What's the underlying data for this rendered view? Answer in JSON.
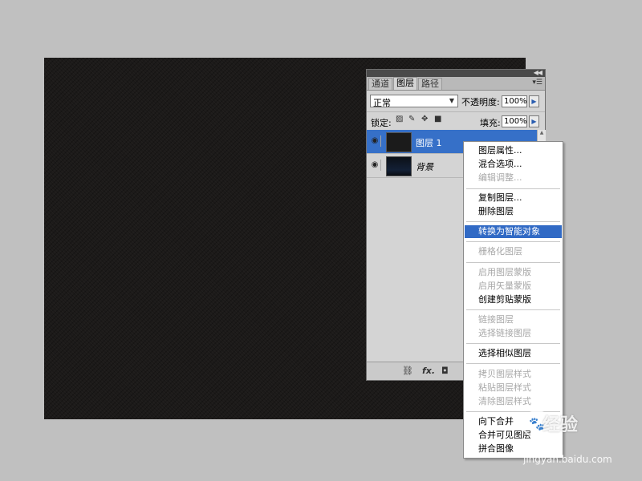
{
  "panel": {
    "collapse_icon": "double-chevron-right-icon",
    "menu_icon": "panel-menu-icon",
    "tabs": [
      {
        "label": "通道"
      },
      {
        "label": "图层"
      },
      {
        "label": "路径"
      }
    ],
    "blend_mode": "正常",
    "opacity_label": "不透明度:",
    "opacity_value": "100%",
    "lock_label": "锁定:",
    "fill_label": "填充:",
    "fill_value": "100%",
    "layers": [
      {
        "name": "图层 1",
        "selected": true,
        "visible": true
      },
      {
        "name": "背景",
        "selected": false,
        "visible": true
      }
    ],
    "footer_icons": [
      "link-icon",
      "fx-icon",
      "mask-icon"
    ]
  },
  "context_menu": {
    "items": [
      {
        "label": "图层属性...",
        "enabled": true
      },
      {
        "label": "混合选项...",
        "enabled": true
      },
      {
        "label": "编辑调整...",
        "enabled": false
      },
      {
        "label": "复制图层...",
        "enabled": true
      },
      {
        "label": "删除图层",
        "enabled": true
      },
      {
        "label": "转换为智能对象",
        "enabled": true,
        "highlighted": true
      },
      {
        "label": "栅格化图层",
        "enabled": false
      },
      {
        "label": "启用图层蒙版",
        "enabled": false
      },
      {
        "label": "启用矢量蒙版",
        "enabled": false
      },
      {
        "label": "创建剪贴蒙版",
        "enabled": true
      },
      {
        "label": "链接图层",
        "enabled": false
      },
      {
        "label": "选择链接图层",
        "enabled": false
      },
      {
        "label": "选择相似图层",
        "enabled": true
      },
      {
        "label": "拷贝图层样式",
        "enabled": false
      },
      {
        "label": "粘贴图层样式",
        "enabled": false
      },
      {
        "label": "清除图层样式",
        "enabled": false
      },
      {
        "label": "向下合并",
        "enabled": true
      },
      {
        "label": "合并可见图层",
        "enabled": true
      },
      {
        "label": "拼合图像",
        "enabled": true
      }
    ]
  },
  "watermark": {
    "brand": "经验",
    "url": "jingyan.baidu.com"
  },
  "colors": {
    "selection": "#3670c8",
    "menu_highlight": "#316ac5",
    "canvas": "#1c1a19"
  }
}
